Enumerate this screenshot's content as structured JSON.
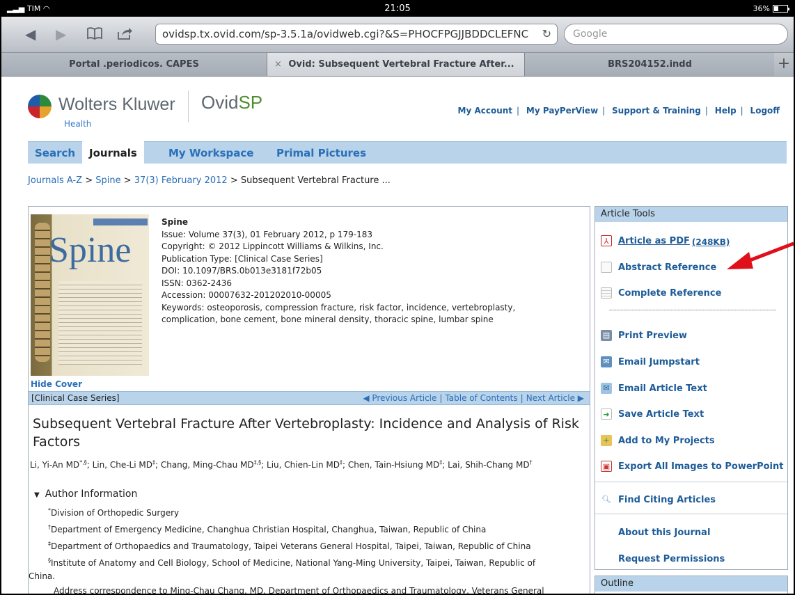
{
  "status_bar": {
    "carrier": "TIM",
    "time": "21:05",
    "battery": "36%",
    "battery_level": 0.36
  },
  "browser": {
    "url": "ovidsp.tx.ovid.com/sp-3.5.1a/ovidweb.cgi?&S=PHOCFPGJJBDDCLEFNC",
    "search_placeholder": "Google",
    "tabs": [
      {
        "label": "Portal .periodicos. CAPES",
        "active": false
      },
      {
        "label": "Ovid: Subsequent Vertebral Fracture After...",
        "active": true
      },
      {
        "label": "BRS204152.indd",
        "active": false
      }
    ],
    "close_glyph": "×",
    "new_tab_glyph": "+"
  },
  "header": {
    "brand": "Wolters Kluwer",
    "brand_sub": "Health",
    "product_prefix": "Ovid",
    "product_suffix": "SP",
    "links": [
      "My Account",
      "My PayPerView",
      "Support & Training",
      "Help",
      "Logoff"
    ]
  },
  "nav": {
    "items": [
      "Search",
      "Journals",
      "My Workspace",
      "Primal Pictures"
    ],
    "active": "Journals"
  },
  "breadcrumb": {
    "items": [
      "Journals A-Z",
      "Spine",
      "37(3) February 2012"
    ],
    "current": "Subsequent Vertebral Fracture ...",
    "sep": " > "
  },
  "article": {
    "cover_title": "Spine",
    "journal": "Spine",
    "issue": "Issue: Volume 37(3), 01 February 2012, p 179-183",
    "copyright": "Copyright: © 2012 Lippincott Williams & Wilkins, Inc.",
    "pub_type": "Publication Type: [Clinical Case Series]",
    "doi": "DOI: 10.1097/BRS.0b013e3181f72b05",
    "issn": "ISSN: 0362-2436",
    "accession": "Accession: 00007632-201202010-00005",
    "keywords_line1": "Keywords: osteoporosis, compression fracture, risk factor, incidence, vertebroplasty,",
    "keywords_line2": "complication, bone cement, bone mineral density, thoracic spine, lumbar spine",
    "hide_cover": "Hide Cover",
    "section_label": "[Clinical Case Series]",
    "prev_article": "◀ Previous Article",
    "toc": "Table of Contents",
    "next_article": "Next Article ▶",
    "title": "Subsequent Vertebral Fracture After Vertebroplasty: Incidence and Analysis of Risk Factors",
    "authors": [
      {
        "name": "Li, Yi-An MD",
        "sup": "*,§"
      },
      {
        "name": "Lin, Che-Li MD",
        "sup": "‡"
      },
      {
        "name": "Chang, Ming-Chau MD",
        "sup": "‡,§"
      },
      {
        "name": "Liu, Chien-Lin MD",
        "sup": "‡"
      },
      {
        "name": "Chen, Tain-Hsiung MD",
        "sup": "‡"
      },
      {
        "name": "Lai, Shih-Chang MD",
        "sup": "†"
      }
    ],
    "author_info_head": "Author Information",
    "affiliations": [
      {
        "sup": "*",
        "text": "Division of Orthopedic Surgery"
      },
      {
        "sup": "†",
        "text": "Department of Emergency Medicine, Changhua Christian Hospital, Changhua, Taiwan, Republic of China"
      },
      {
        "sup": "‡",
        "text": "Department of Orthopaedics and Traumatology, Taipei Veterans General Hospital, Taipei, Taiwan, Republic of China"
      },
      {
        "sup": "§",
        "text": "Institute of Anatomy and Cell Biology, School of Medicine, National Yang-Ming University, Taipei, Taiwan, Republic of"
      }
    ],
    "affil_wrap": "China.",
    "correspondence": "Address correspondence to Ming-Chau Chang, MD, Department of Orthopaedics and Traumatology, Veterans General"
  },
  "tools": {
    "head": "Article Tools",
    "pdf_label": "Article as PDF",
    "pdf_size": "(248KB)",
    "abstract_ref": "Abstract Reference",
    "complete_ref": "Complete Reference",
    "print_preview": "Print Preview",
    "email_jumpstart": "Email Jumpstart",
    "email_text": "Email Article Text",
    "save_text": "Save Article Text",
    "add_projects": "Add to My Projects",
    "export_ppt": "Export All Images to PowerPoint",
    "find_citing": "Find Citing Articles",
    "about_journal": "About this Journal",
    "request_permissions": "Request Permissions"
  },
  "outline": {
    "head": "Outline"
  },
  "colors": {
    "annotation_arrow": "#e0101a",
    "link": "#1e5c98",
    "nav_bar": "#b8d3ea"
  }
}
